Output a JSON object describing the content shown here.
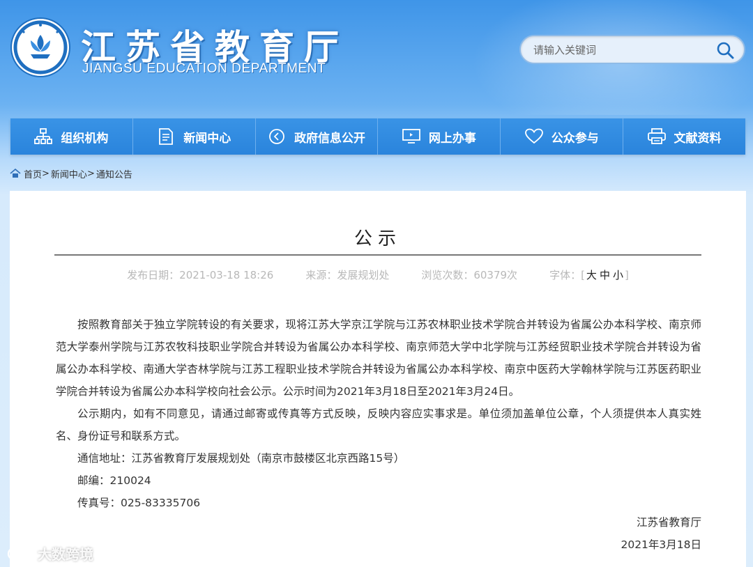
{
  "header": {
    "title": "江苏省教育厅",
    "subtitle": "JIANGSU EDUCATION DEPARTMENT",
    "search_placeholder": "请输入关键词",
    "logo_icon": "jiangsu-education-emblem",
    "search_icon": "search-icon"
  },
  "nav": {
    "items": [
      {
        "label": "组织机构",
        "icon": "org-chart-icon"
      },
      {
        "label": "新闻中心",
        "icon": "document-icon"
      },
      {
        "label": "政府信息公开",
        "icon": "circle-arrow-icon"
      },
      {
        "label": "网上办事",
        "icon": "monitor-icon"
      },
      {
        "label": "公众参与",
        "icon": "heart-icon"
      },
      {
        "label": "文献资料",
        "icon": "printer-icon"
      }
    ]
  },
  "breadcrumb": {
    "home": "首页",
    "sep": ">",
    "level1": "新闻中心",
    "level2": "通知公告"
  },
  "article": {
    "title": "公示",
    "publish_date": "发布日期：2021-03-18 18:26",
    "source": "来源：发展规划处",
    "views": "浏览次数：60379次",
    "font_label": "字体：[",
    "font_large": "大",
    "font_medium": "中",
    "font_small": "小",
    "font_close": "]",
    "paragraphs": [
      "按照教育部关于独立学院转设的有关要求，现将江苏大学京江学院与江苏农林职业技术学院合并转设为省属公办本科学校、南京师范大学泰州学院与江苏农牧科技职业学院合并转设为省属公办本科学校、南京师范大学中北学院与江苏经贸职业技术学院合并转设为省属公办本科学校、南通大学杏林学院与江苏工程职业技术学院合并转设为省属公办本科学校、南京中医药大学翰林学院与江苏医药职业学院合并转设为省属公办本科学校向社会公示。公示时间为2021年3月18日至2021年3月24日。",
      "公示期内，如有不同意见，请通过邮寄或传真等方式反映，反映内容应实事求是。单位须加盖单位公章，个人须提供本人真实姓名、身份证号和联系方式。"
    ],
    "address": "通信地址：江苏省教育厅发展规划处（南京市鼓楼区北京西路15号）",
    "postcode": "邮编：210024",
    "fax": "传真号：025-83335706",
    "signer": "江苏省教育厅",
    "sign_date": "2021年3月18日"
  },
  "watermark": {
    "text": "大数跨境"
  },
  "colors": {
    "nav_bg": "#2f8ae0",
    "header_blue": "#3f95e8",
    "meta_gray": "#b8b8b8"
  }
}
